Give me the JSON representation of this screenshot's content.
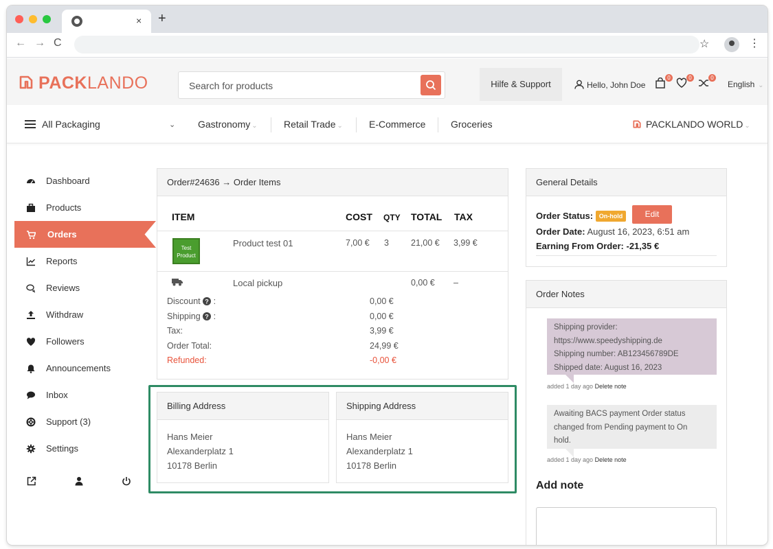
{
  "browser": {
    "tab_close": "×",
    "new_tab": "+",
    "nav_back": "←",
    "nav_forward": "→",
    "nav_reload": "C",
    "bookmark_star": "☆",
    "menu_kebab": "⋮"
  },
  "header": {
    "logo_bold": "PACK",
    "logo_light": "LANDO",
    "search_placeholder": "Search for products",
    "help_label": "Hilfe & Support",
    "greeting": "Hello, John Doe",
    "cart_count": "0",
    "wishlist_count": "0",
    "compare_count": "0",
    "language": "English"
  },
  "catnav": {
    "all_packaging": "All Packaging",
    "items": [
      "Gastronomy",
      "Retail Trade",
      "E-Commerce",
      "Groceries"
    ],
    "world": "PACKLANDO WORLD"
  },
  "sidebar": {
    "items": [
      {
        "label": "Dashboard",
        "icon": "dashboard-icon"
      },
      {
        "label": "Products",
        "icon": "briefcase-icon"
      },
      {
        "label": "Orders",
        "icon": "cart-icon"
      },
      {
        "label": "Reports",
        "icon": "chart-icon"
      },
      {
        "label": "Reviews",
        "icon": "comments-icon"
      },
      {
        "label": "Withdraw",
        "icon": "upload-icon"
      },
      {
        "label": "Followers",
        "icon": "heart-icon"
      },
      {
        "label": "Announcements",
        "icon": "bell-icon"
      },
      {
        "label": "Inbox",
        "icon": "chat-icon"
      },
      {
        "label": "Support (3)",
        "icon": "lifebuoy-icon"
      },
      {
        "label": "Settings",
        "icon": "gear-icon"
      }
    ],
    "active_index": 2
  },
  "order_items": {
    "title": "Order#24636 → Order Items",
    "columns": {
      "item": "ITEM",
      "cost": "COST",
      "qty": "QTY",
      "total": "TOTAL",
      "tax": "TAX"
    },
    "thumb_text": [
      "Test",
      "Product"
    ],
    "product": {
      "name": "Product test 01",
      "cost": "7,00 €",
      "qty": "3",
      "total": "21,00 €",
      "tax": "3,99 €"
    },
    "shipping_line": {
      "name": "Local pickup",
      "total": "0,00 €",
      "tax": "–"
    },
    "totals": [
      {
        "label": "Discount",
        "value": "0,00 €",
        "help": true
      },
      {
        "label": "Shipping",
        "value": "0,00 €",
        "help": true
      },
      {
        "label": "Tax:",
        "value": "3,99 €"
      },
      {
        "label": "Order Total:",
        "value": "24,99 €"
      },
      {
        "label": "Refunded:",
        "value": "-0,00 €"
      }
    ]
  },
  "billing": {
    "title": "Billing Address",
    "lines": [
      "Hans Meier",
      "Alexanderplatz 1",
      "10178 Berlin"
    ]
  },
  "shipping": {
    "title": "Shipping Address",
    "lines": [
      "Hans Meier",
      "Alexanderplatz 1",
      "10178 Berlin"
    ]
  },
  "general": {
    "title": "General Details",
    "status_label": "Order Status:",
    "status_value": "On-hold",
    "edit_label": "Edit",
    "date_label": "Order Date:",
    "date_value": "August 16, 2023, 6:51 am",
    "earning_label": "Earning From Order:",
    "earning_value": "-21,35 €"
  },
  "notes": {
    "title": "Order Notes",
    "items": [
      {
        "lines": [
          "Shipping provider:",
          "https://www.speedyshipping.de",
          "Shipping number: AB123456789DE",
          "Shipped date: August 16, 2023"
        ],
        "meta": "added 1 day ago",
        "delete": "Delete note"
      },
      {
        "lines": [
          "Awaiting BACS payment Order status",
          "changed from Pending payment to On",
          "hold."
        ],
        "meta": "added 1 day ago",
        "delete": "Delete note"
      }
    ],
    "add_note_title": "Add note"
  }
}
